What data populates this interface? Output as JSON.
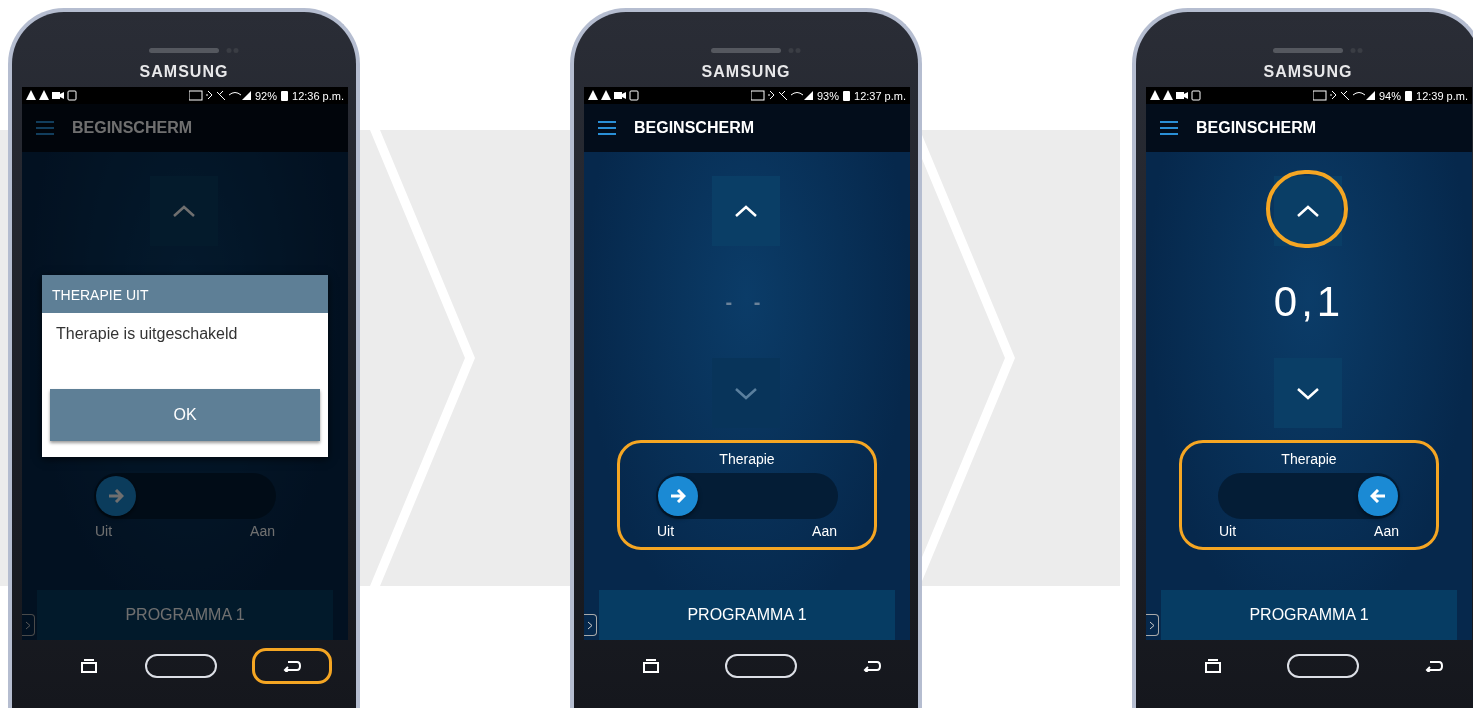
{
  "phones": [
    {
      "brand": "SAMSUNG",
      "status": {
        "battery": "92%",
        "time": "12:36 p.m."
      },
      "dimmed": true,
      "app_bar": {
        "title": "BEGINSCHERM"
      },
      "up_button": {
        "highlighted": false,
        "disabled": false
      },
      "toggle": {
        "on": false,
        "highlighted": false,
        "off_label": "Uit",
        "on_label": "Aan"
      },
      "program_button": "PROGRAMMA 1",
      "dialog": {
        "title": "THERAPIE UIT",
        "message": "Therapie is uitgeschakeld",
        "button": "OK"
      },
      "back_key": {
        "highlighted": true
      }
    },
    {
      "brand": "SAMSUNG",
      "status": {
        "battery": "93%",
        "time": "12:37 p.m."
      },
      "dimmed": false,
      "app_bar": {
        "title": "BEGINSCHERM"
      },
      "up_button": {
        "highlighted": false,
        "disabled": false
      },
      "value": {
        "text": "- -",
        "dimmed": true
      },
      "down_button": {
        "disabled": true
      },
      "toggle": {
        "label": "Therapie",
        "on": false,
        "highlighted": true,
        "off_label": "Uit",
        "on_label": "Aan"
      },
      "program_button": "PROGRAMMA 1",
      "back_key": {
        "highlighted": false
      }
    },
    {
      "brand": "SAMSUNG",
      "status": {
        "battery": "94%",
        "time": "12:39 p.m."
      },
      "dimmed": false,
      "app_bar": {
        "title": "BEGINSCHERM"
      },
      "up_button": {
        "highlighted": true,
        "disabled": false
      },
      "value": {
        "text": "0,1",
        "dimmed": false
      },
      "down_button": {
        "disabled": false
      },
      "toggle": {
        "label": "Therapie",
        "on": true,
        "highlighted": true,
        "off_label": "Uit",
        "on_label": "Aan"
      },
      "program_button": "PROGRAMMA 1",
      "back_key": {
        "highlighted": false
      }
    }
  ]
}
